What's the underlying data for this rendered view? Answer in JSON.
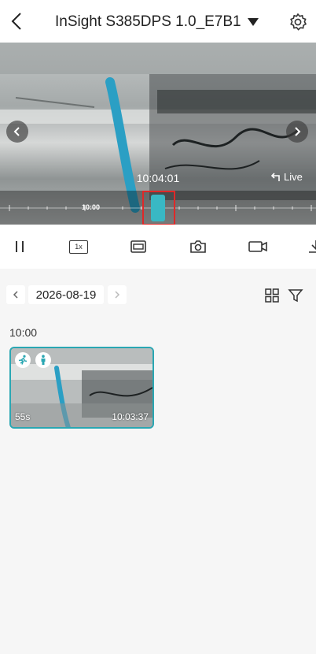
{
  "header": {
    "title": "InSight S385DPS 1.0_E7B1"
  },
  "player": {
    "timestamp": "10:04:01",
    "live_label": "Live",
    "timeline_label": "10:00"
  },
  "controls": {
    "speed_label": "1x",
    "items": [
      "pause-icon",
      "speed-icon",
      "fullscreen-icon",
      "snapshot-camera-icon",
      "record-video-icon",
      "download-icon"
    ]
  },
  "date_bar": {
    "date": "2026-08-19"
  },
  "recordings": {
    "hour_label": "10:00",
    "clips": [
      {
        "duration": "55s",
        "time": "10:03:37",
        "event_icons": [
          "running-person-icon",
          "person-icon"
        ]
      }
    ]
  },
  "colors": {
    "accent": "#39b8c4",
    "selection": "#e02828",
    "card_border": "#2aa7b3"
  }
}
